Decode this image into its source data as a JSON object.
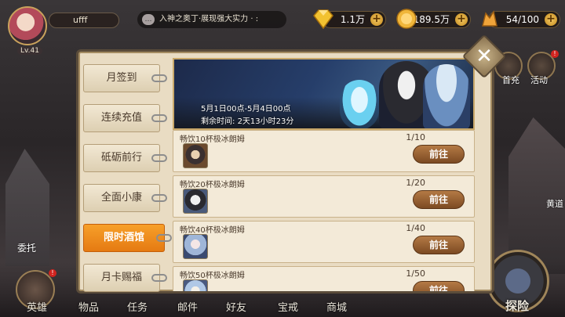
{
  "player": {
    "name": "ufff",
    "level": "Lv.41"
  },
  "ticker": {
    "text": "入神之奥丁·展现强大实力 · :"
  },
  "resources": {
    "diamonds": "1.1万",
    "gold": "189.5万",
    "stamina": "54/100"
  },
  "side_icons": {
    "top_right_a": "首充",
    "top_right_b": "活动",
    "yellow_label": "黄道"
  },
  "panel": {
    "tabs": [
      {
        "label": "月签到",
        "active": false
      },
      {
        "label": "连续充值",
        "active": false
      },
      {
        "label": "砥砺前行",
        "active": false
      },
      {
        "label": "全面小康",
        "active": false
      },
      {
        "label": "限时酒馆",
        "active": true
      },
      {
        "label": "月卡赐福",
        "active": false
      }
    ],
    "banner": {
      "date_range": "5月1日00点-5月4日00点",
      "remaining_label": "剩余时间:",
      "remaining_value": "2天13小时23分"
    },
    "tasks": [
      {
        "title": "畅饮10杯极冰朗姆",
        "progress": "1/10",
        "button": "前往"
      },
      {
        "title": "畅饮20杯极冰朗姆",
        "progress": "1/20",
        "button": "前往"
      },
      {
        "title": "畅饮40杯极冰朗姆",
        "progress": "1/40",
        "button": "前往"
      },
      {
        "title": "畅饮50杯极冰朗姆",
        "progress": "1/50",
        "button": "前往"
      }
    ]
  },
  "bottom_nav": {
    "hero": "英雄",
    "items": "物品",
    "tasks": "任务",
    "mail": "邮件",
    "friends": "好友",
    "treasure": "宝戒",
    "shop": "商城",
    "explore": "探险",
    "entrust": "委托"
  },
  "badges": {
    "alert": "!"
  }
}
